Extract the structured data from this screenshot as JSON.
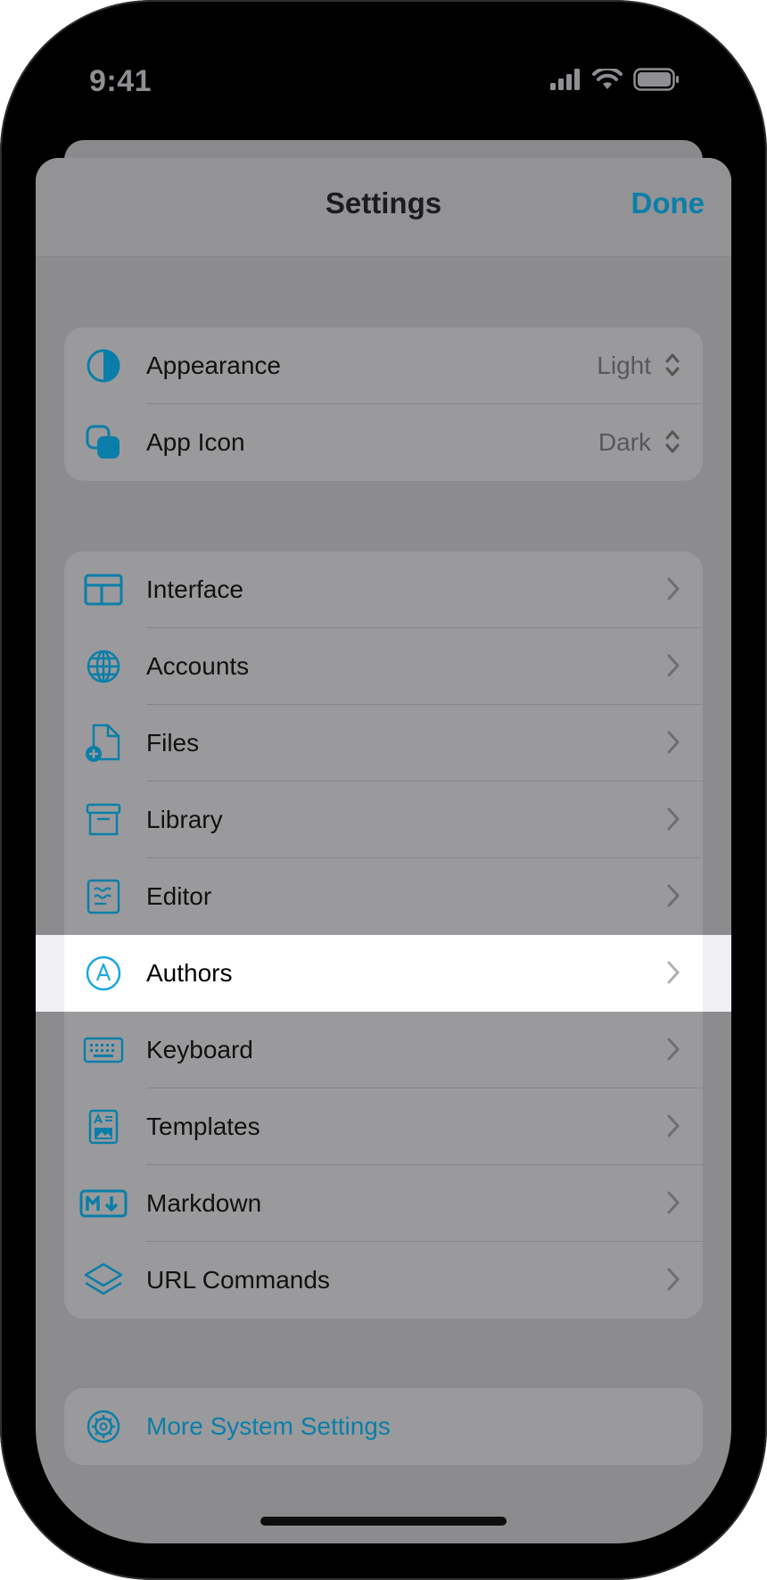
{
  "status_bar": {
    "time": "9:41"
  },
  "nav": {
    "title": "Settings",
    "done_label": "Done"
  },
  "accent_color": "#0a7ea8",
  "group_display": [
    {
      "icon": "appearance-icon",
      "label": "Appearance",
      "value": "Light"
    },
    {
      "icon": "app-icon-icon",
      "label": "App Icon",
      "value": "Dark"
    }
  ],
  "group_main": [
    {
      "icon": "interface-icon",
      "label": "Interface"
    },
    {
      "icon": "globe-icon",
      "label": "Accounts"
    },
    {
      "icon": "file-plus-icon",
      "label": "Files"
    },
    {
      "icon": "archive-box-icon",
      "label": "Library"
    },
    {
      "icon": "editor-icon",
      "label": "Editor"
    },
    {
      "icon": "author-circle-icon",
      "label": "Authors",
      "highlighted": true
    },
    {
      "icon": "keyboard-icon",
      "label": "Keyboard"
    },
    {
      "icon": "template-icon",
      "label": "Templates"
    },
    {
      "icon": "markdown-icon",
      "label": "Markdown"
    },
    {
      "icon": "layers-icon",
      "label": "URL Commands"
    }
  ],
  "more": {
    "icon": "gear-icon",
    "label": "More System Settings"
  }
}
